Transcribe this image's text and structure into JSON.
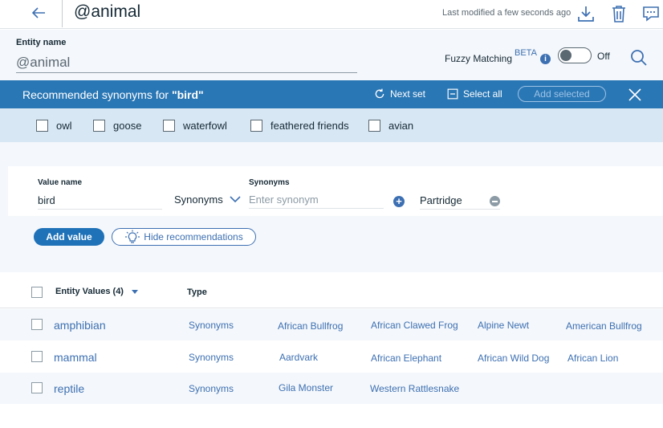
{
  "header": {
    "title": "@animal",
    "modified": "Last modified a few seconds ago"
  },
  "entity": {
    "label": "Entity name",
    "value": "@animal",
    "fuzzy_label": "Fuzzy Matching",
    "beta": "BETA",
    "toggle_state": "Off"
  },
  "recommendations": {
    "title_prefix": "Recommended synonyms for ",
    "term": "\"bird\"",
    "next_set": "Next set",
    "select_all": "Select all",
    "add_selected": "Add selected",
    "items": [
      "owl",
      "goose",
      "waterfowl",
      "feathered friends",
      "avian"
    ]
  },
  "editor": {
    "value_name_label": "Value name",
    "value_name": "bird",
    "type_select": "Synonyms",
    "synonyms_label": "Synonyms",
    "synonym_placeholder": "Enter synonym",
    "synonym_chip": "Partridge",
    "add_value": "Add value",
    "hide_recommendations": "Hide recommendations"
  },
  "table": {
    "col_values": "Entity Values (4)",
    "col_type": "Type",
    "rows": [
      {
        "name": "amphibian",
        "type": "Synonyms",
        "synonyms": [
          "African Bullfrog",
          "African Clawed Frog",
          "Alpine Newt",
          "American Bullfrog"
        ]
      },
      {
        "name": "mammal",
        "type": "Synonyms",
        "synonyms": [
          "Aardvark",
          "African Elephant",
          "African Wild Dog",
          "African Lion"
        ]
      },
      {
        "name": "reptile",
        "type": "Synonyms",
        "synonyms": [
          "Gila Monster",
          "Western Rattlesnake"
        ]
      }
    ]
  },
  "colors": {
    "accent": "#3d70b2",
    "rec_bar": "#2a77b5",
    "rec_items_bg": "#d8e7f4"
  }
}
